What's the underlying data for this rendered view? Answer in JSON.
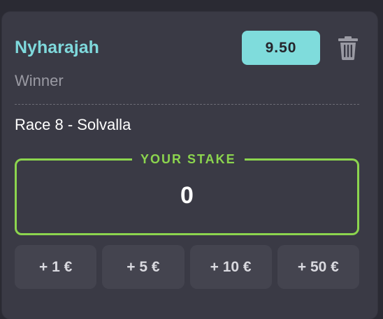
{
  "bet": {
    "selection_name": "Nyharajah",
    "market": "Winner",
    "odds": "9.50",
    "race": "Race 8 - Solvalla",
    "delete_icon": "trash-icon"
  },
  "stake": {
    "legend": "YOUR STAKE",
    "value": "0"
  },
  "quick_stakes": [
    {
      "label": "+ 1 €"
    },
    {
      "label": "+ 5 €"
    },
    {
      "label": "+ 10 €"
    },
    {
      "label": "+ 50 €"
    }
  ],
  "colors": {
    "accent_cyan": "#7fd9dc",
    "stake_green": "#8cd54e",
    "card_bg": "#3a3a45",
    "page_bg": "#2a2a33"
  }
}
